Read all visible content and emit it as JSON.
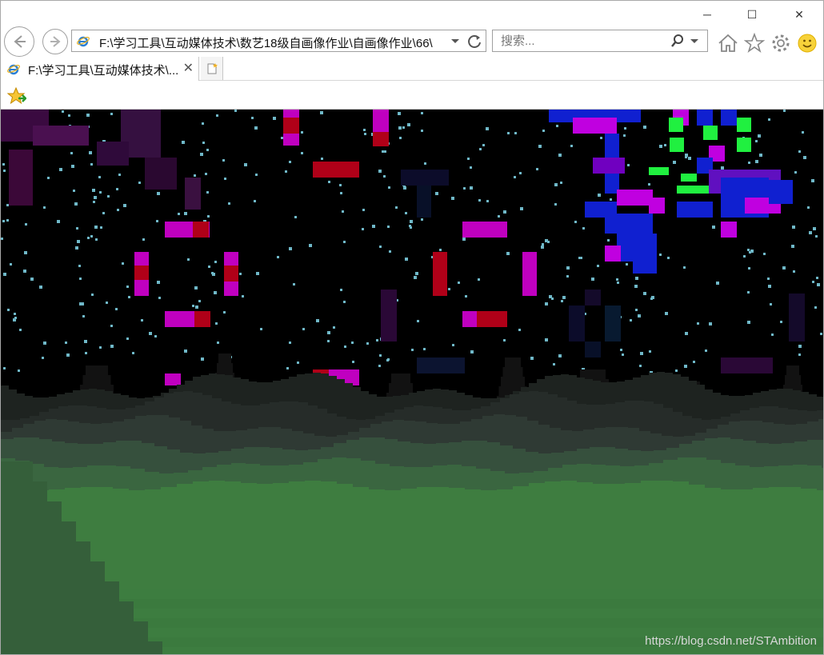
{
  "window": {
    "minimize_label": "─",
    "maximize_label": "☐",
    "close_label": "✕"
  },
  "address": {
    "url": "F:\\学习工具\\互动媒体技术\\数艺18级自画像作业\\自画像作业\\66\\"
  },
  "search": {
    "placeholder": "搜索..."
  },
  "tabs": [
    {
      "title": "F:\\学习工具\\互动媒体技术\\...",
      "close_label": "✕"
    }
  ],
  "icons": {
    "back": "back-arrow-icon",
    "forward": "forward-arrow-icon",
    "ie": "ie-logo-icon",
    "dropdown": "chevron-down-icon",
    "refresh": "refresh-icon",
    "search": "magnifier-icon",
    "home": "home-icon",
    "favorites": "star-icon",
    "settings": "gear-icon",
    "feedback": "smiley-icon",
    "new_tab": "new-tab-icon",
    "add_favorite": "add-favorite-star-icon"
  },
  "colors": {
    "sky": "#000000",
    "grass": "#3e7d40",
    "hills_dark": "#2a2f2d",
    "pixel_magenta": "#b800b8",
    "pixel_red": "#b00010",
    "pixel_blue": "#1020d0",
    "pixel_green": "#20f040",
    "star": "#6fb8c8"
  },
  "watermark": "https://blog.csdn.net/STAmbition"
}
